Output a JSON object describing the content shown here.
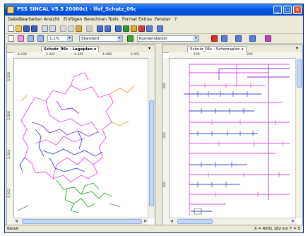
{
  "window": {
    "title": "PSS SINCAL V5.5 20080ct - lfof_Schutz_06c",
    "buttons": {
      "minimize": "_",
      "maximize": "□",
      "close": "×"
    }
  },
  "menu": [
    "Datei",
    "Bearbeiten",
    "Ansicht",
    "Einfügen",
    "Berechnen",
    "Tools",
    "Format",
    "Extras",
    "Fenster",
    "?"
  ],
  "toolbar2": {
    "zoom": "1,1%",
    "style": "Standard",
    "station": "Kundenstation"
  },
  "left_pane": {
    "tab": "Schutz_06c - Lageplan",
    "tab_close": "x",
    "ruler_h": [
      "4.439",
      "4.442",
      "4.445",
      "4.448",
      "4.451"
    ],
    "ruler_v": [
      "5.508",
      "5.506",
      "5.504",
      "5.502"
    ]
  },
  "right_pane": {
    "tab": "Schutz_06c - Schemaplan",
    "tab_close": "x",
    "ruler_h": [
      "100",
      "200"
    ],
    "ruler_v": [
      "100",
      "200",
      "300"
    ]
  },
  "status": {
    "left": "Bereit",
    "right": "X = 4501,182 km  Y = 5"
  },
  "colors": {
    "titlebar": "#0058e6",
    "line_pink": "#e24be0",
    "line_blue": "#2f3fd0",
    "line_green": "#2aa32a",
    "line_orange": "#f0a040",
    "line_purple": "#8a2be2"
  }
}
